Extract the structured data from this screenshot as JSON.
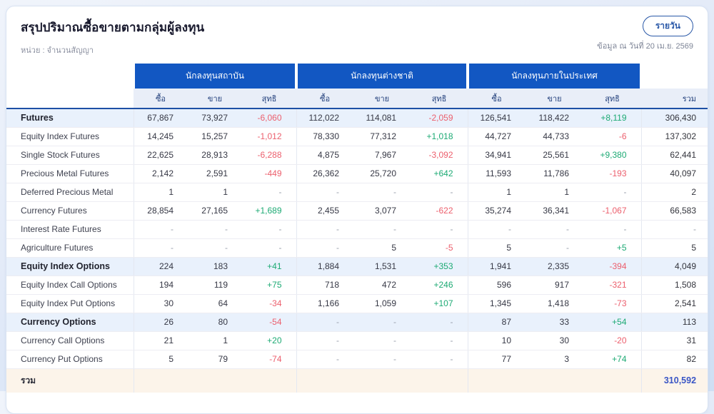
{
  "page": {
    "title": "สรุปปริมาณซื้อขายตามกลุ่มผู้ลงทุน",
    "unit_label": "หน่วย : จำนวนสัญญา",
    "as_of_label": "ข้อมูล ณ วันที่ 20 เม.ย. 2569",
    "period_button_label": "รายวัน"
  },
  "colors": {
    "accent_blue": "#1257c2",
    "positive_green": "#1daa74",
    "negative_red": "#ec5f6d",
    "total_blue": "#3a56c5",
    "footer_bg": "#fcf4ea",
    "group_row_bg": "#e9f1fc"
  },
  "table": {
    "groups": [
      "นักลงทุนสถาบัน",
      "นักลงทุนต่างชาติ",
      "นักลงทุนภายในประเทศ"
    ],
    "sub_headers": [
      "ซื้อ",
      "ขาย",
      "สุทธิ"
    ],
    "total_header": "รวม",
    "rows": [
      {
        "label": "Futures",
        "group": true,
        "cells": [
          "67,867",
          "73,927",
          "-6,060",
          "112,022",
          "114,081",
          "-2,059",
          "126,541",
          "118,422",
          "+8,119"
        ],
        "total": "306,430"
      },
      {
        "label": "Equity Index Futures",
        "group": false,
        "cells": [
          "14,245",
          "15,257",
          "-1,012",
          "78,330",
          "77,312",
          "+1,018",
          "44,727",
          "44,733",
          "-6"
        ],
        "total": "137,302"
      },
      {
        "label": "Single Stock Futures",
        "group": false,
        "cells": [
          "22,625",
          "28,913",
          "-6,288",
          "4,875",
          "7,967",
          "-3,092",
          "34,941",
          "25,561",
          "+9,380"
        ],
        "total": "62,441"
      },
      {
        "label": "Precious Metal Futures",
        "group": false,
        "cells": [
          "2,142",
          "2,591",
          "-449",
          "26,362",
          "25,720",
          "+642",
          "11,593",
          "11,786",
          "-193"
        ],
        "total": "40,097"
      },
      {
        "label": "Deferred Precious Metal",
        "group": false,
        "cells": [
          "1",
          "1",
          "-",
          "-",
          "-",
          "-",
          "1",
          "1",
          "-"
        ],
        "total": "2"
      },
      {
        "label": "Currency Futures",
        "group": false,
        "cells": [
          "28,854",
          "27,165",
          "+1,689",
          "2,455",
          "3,077",
          "-622",
          "35,274",
          "36,341",
          "-1,067"
        ],
        "total": "66,583"
      },
      {
        "label": "Interest Rate Futures",
        "group": false,
        "cells": [
          "-",
          "-",
          "-",
          "-",
          "-",
          "-",
          "-",
          "-",
          "-"
        ],
        "total": "-"
      },
      {
        "label": "Agriculture Futures",
        "group": false,
        "cells": [
          "-",
          "-",
          "-",
          "-",
          "5",
          "-5",
          "5",
          "-",
          "+5"
        ],
        "total": "5"
      },
      {
        "label": "Equity Index Options",
        "group": true,
        "cells": [
          "224",
          "183",
          "+41",
          "1,884",
          "1,531",
          "+353",
          "1,941",
          "2,335",
          "-394"
        ],
        "total": "4,049"
      },
      {
        "label": "Equity Index Call Options",
        "group": false,
        "cells": [
          "194",
          "119",
          "+75",
          "718",
          "472",
          "+246",
          "596",
          "917",
          "-321"
        ],
        "total": "1,508"
      },
      {
        "label": "Equity Index Put Options",
        "group": false,
        "cells": [
          "30",
          "64",
          "-34",
          "1,166",
          "1,059",
          "+107",
          "1,345",
          "1,418",
          "-73"
        ],
        "total": "2,541"
      },
      {
        "label": "Currency Options",
        "group": true,
        "cells": [
          "26",
          "80",
          "-54",
          "-",
          "-",
          "-",
          "87",
          "33",
          "+54"
        ],
        "total": "113"
      },
      {
        "label": "Currency Call Options",
        "group": false,
        "cells": [
          "21",
          "1",
          "+20",
          "-",
          "-",
          "-",
          "10",
          "30",
          "-20"
        ],
        "total": "31"
      },
      {
        "label": "Currency Put Options",
        "group": false,
        "cells": [
          "5",
          "79",
          "-74",
          "-",
          "-",
          "-",
          "77",
          "3",
          "+74"
        ],
        "total": "82"
      }
    ],
    "footer": {
      "label": "รวม",
      "cells": [
        "",
        "",
        "",
        "",
        "",
        "",
        "",
        "",
        ""
      ],
      "total": "310,592"
    }
  }
}
